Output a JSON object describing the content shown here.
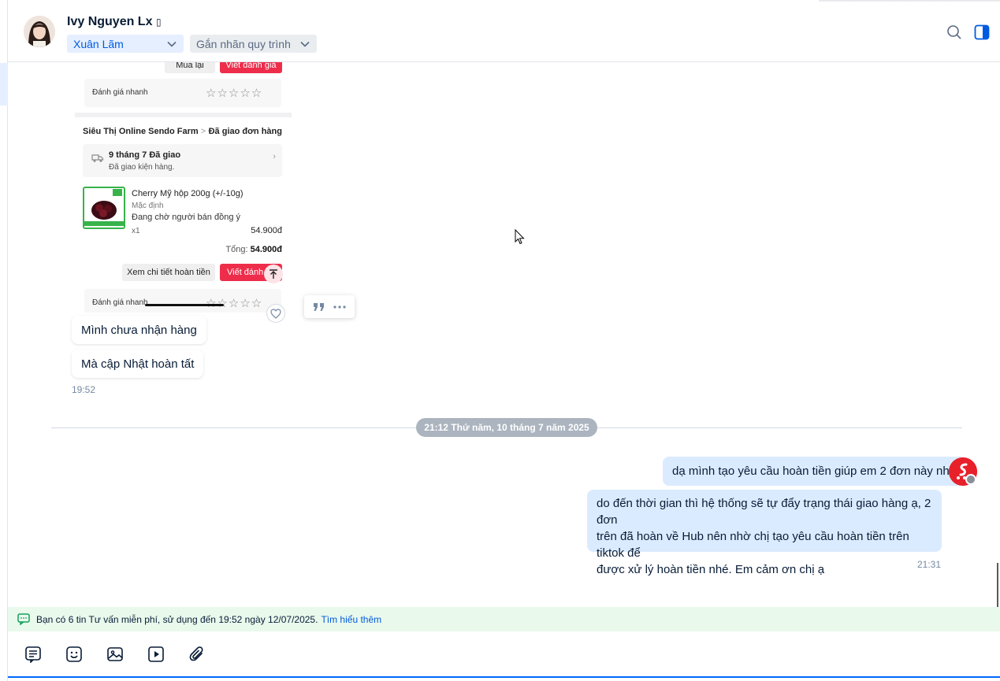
{
  "header": {
    "contact_name": "Ivy Nguyen Lx",
    "contact_name_suffix": "▯",
    "assignee": "Xuân Lãm",
    "tag_placeholder": "Gắn nhãn quy trình"
  },
  "shared_image": {
    "top_buttons": {
      "rebuy": "Mua lại",
      "review": "Viết đánh giá"
    },
    "quick_rating_label": "Đánh giá nhanh",
    "stars": "☆☆☆☆☆",
    "shop_name": "Siêu Thị Online Sendo Farm",
    "shop_chevron": ">",
    "order_status": "Đã giao đơn hàng",
    "delivery_title": "9 tháng 7 Đã giao",
    "delivery_subtitle": "Đã giao kiện hàng.",
    "delivery_chevron": "›",
    "product_name": "Cherry Mỹ hộp 200g (+/-10g)",
    "product_variant": "Mặc định",
    "product_status": "Đang chờ người bán đồng ý",
    "product_qty": "x1",
    "product_price": "54.900đ",
    "total_label": "Tổng:",
    "total_value": "54.900đ",
    "refund_detail_button": "Xem chi tiết hoàn tiền",
    "review_button": "Viết đánh",
    "quick_rating_label_2": "Đánh giá nhanh"
  },
  "incoming": {
    "messages": [
      "Mình chưa nhận hàng",
      "Mà cập Nhật hoàn tất"
    ],
    "time": "19:52"
  },
  "divider_label": "21:12 Thứ năm, 10 tháng 7 năm 2025",
  "outgoing": {
    "message_1": "dạ mình tạo yêu cầu hoàn tiền giúp em 2 đơn này nhé",
    "message_2_lines": [
      "do đến thời gian thì hệ thống sẽ tự đẩy trạng thái giao hàng ạ, 2 đơn",
      "trên đã hoàn về Hub nên nhờ chị tạo yêu cầu hoàn tiền trên tiktok để",
      "được xử lý hoàn tiền nhé. Em cảm ơn chị ạ"
    ],
    "time": "21:31"
  },
  "notice": {
    "text": "Bạn có 6 tin Tư vấn miễn phí, sử dụng đến 19:52 ngày 12/07/2025.",
    "link": "Tìm hiểu thêm"
  },
  "colors": {
    "accent": "#005ae0",
    "outgoing_bubble": "#dbebff",
    "notice_bg": "#e9f9ec",
    "sendo_red": "#ee2d4b"
  },
  "icons": [
    "search-icon",
    "side-panel-icon",
    "chevron-down-icon",
    "quote-icon",
    "more-icon",
    "heart-icon",
    "message-icon",
    "quick-message-icon",
    "sticker-icon",
    "image-icon",
    "video-icon",
    "attachment-icon"
  ]
}
